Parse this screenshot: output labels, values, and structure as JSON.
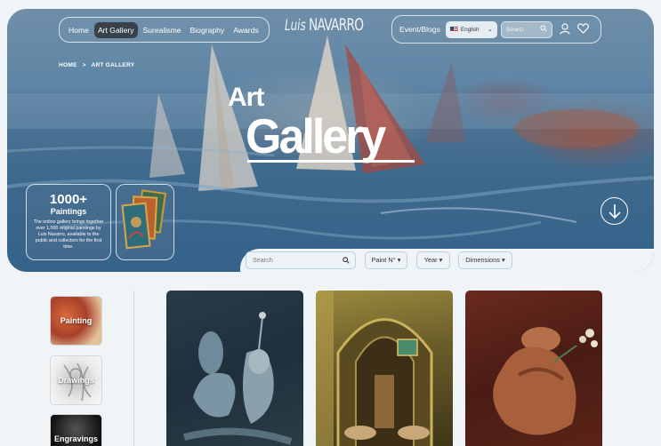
{
  "nav": {
    "items": [
      {
        "label": "Home",
        "active": false
      },
      {
        "label": "Art Gallery",
        "active": true
      },
      {
        "label": "Surealisme",
        "active": false
      },
      {
        "label": "Biography",
        "active": false
      },
      {
        "label": "Awards",
        "active": false
      }
    ],
    "events_label": "Event/Blogs",
    "language": "English",
    "search_placeholder": "Searcl",
    "icons": [
      "user-icon",
      "heart-icon"
    ]
  },
  "logo": {
    "first": "Luis",
    "last": "NAVARRO"
  },
  "breadcrumb": {
    "home": "HOME",
    "separator": ">",
    "current": "ART GALLERY"
  },
  "hero": {
    "title_line1": "Art",
    "title_line2": "Gallery",
    "stat_number": "1000+",
    "stat_label": "Paintings",
    "stat_description": "The online gallery brings together over 1,000 original paintings by Luis Navarro, available to the public and collectors for the first time."
  },
  "filters": {
    "search_placeholder": "Search",
    "paint_label": "Paint N°",
    "year_label": "Year",
    "dimensions_label": "Dimensions"
  },
  "categories": [
    {
      "label": "Painting"
    },
    {
      "label": "Drawings"
    },
    {
      "label": "Engravings"
    }
  ],
  "colors": {
    "hero_blue": "#3f6a8e",
    "page_bg": "#f1f4f7",
    "pill_border": "#ffffff",
    "filter_border": "#b8d3e4"
  }
}
